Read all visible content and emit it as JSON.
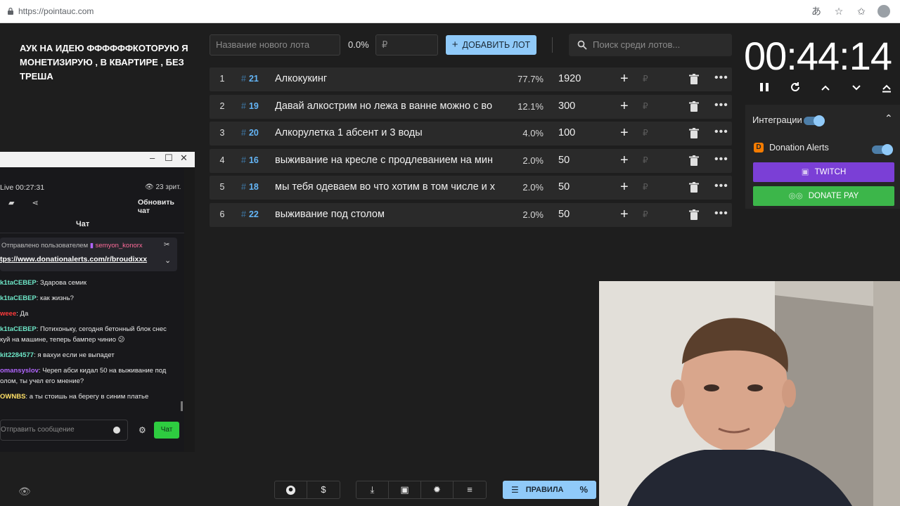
{
  "browser": {
    "url": "https://pointauc.com",
    "icons": [
      "translate-icon",
      "star-icon",
      "bookmarks-icon",
      "profile-icon"
    ]
  },
  "auction": {
    "title": "АУК НА ИДЕЮ ФФФФФФКОТОРУЮ Я МОНЕТИЗИРУЮ , В КВАРТИРЕ , БЕЗ ТРЕША"
  },
  "controls": {
    "new_lot_placeholder": "Название нового лота",
    "percent": "0.0%",
    "amount_placeholder": "₽",
    "add_lot_label": "ДОБАВИТЬ ЛОТ",
    "search_placeholder": "Поиск среди лотов..."
  },
  "lots": [
    {
      "num": "1",
      "id": "21",
      "name": "Алкокукинг",
      "pct": "77.7%",
      "amount": "1920"
    },
    {
      "num": "2",
      "id": "19",
      "name": "Давай алкострим но лежа в ванне можно с во",
      "pct": "12.1%",
      "amount": "300"
    },
    {
      "num": "3",
      "id": "20",
      "name": "Алкорулетка 1 абсент и 3 воды",
      "pct": "4.0%",
      "amount": "100"
    },
    {
      "num": "4",
      "id": "16",
      "name": "выживание на кресле с продлеванием на мин",
      "pct": "2.0%",
      "amount": "50"
    },
    {
      "num": "5",
      "id": "18",
      "name": "мы тебя одеваем во что хотим в том числе и х",
      "pct": "2.0%",
      "amount": "50"
    },
    {
      "num": "6",
      "id": "22",
      "name": "выживание под столом",
      "pct": "2.0%",
      "amount": "50"
    }
  ],
  "lot_row": {
    "hash": "#",
    "plus": "+",
    "rub": "₽",
    "dots": "•••"
  },
  "timer": {
    "value": "00:44:14",
    "controls": [
      "pause-icon",
      "restart-icon",
      "increase-icon",
      "decrease-icon",
      "top-icon"
    ]
  },
  "integrations": {
    "label": "Интеграции",
    "enabled": true,
    "donation_alerts": "Donation Alerts",
    "donation_alerts_logo": "D",
    "twitch": "TWITCH",
    "donate_pay": "DONATE PAY",
    "colors": {
      "twitch": "#7b3fd6",
      "donate_pay": "#3cb64a",
      "accent": "#90caf9"
    }
  },
  "chat_window": {
    "controls": [
      "minimize-icon",
      "maximize-icon",
      "close-icon"
    ],
    "live": "Live 00:27:31",
    "viewers": "23 зрит.",
    "refresh": "Обновить чат",
    "tab": "Чат",
    "pinned_prefix": "Отправлено пользователем",
    "pinned_user": "semyon_konorx",
    "pinned_link": "tps://www.donationalerts.com/r/broudixxx",
    "messages": [
      {
        "user": "k1taСЕВЕР",
        "color": "#6ee7c8",
        "text": ": Здарова семик"
      },
      {
        "user": "k1taСЕВЕР",
        "color": "#6ee7c8",
        "text": ": как жизнь?"
      },
      {
        "user": "weee",
        "color": "#ff3b3b",
        "text": ": Да"
      },
      {
        "user": "k1taСЕВЕР",
        "color": "#6ee7c8",
        "text": ": Потихоньку, сегодня бетонный блок снес"
      },
      {
        "user": "",
        "color": "#e8e8e8",
        "text": "куй на машине, теперь бампер чинио 😕"
      },
      {
        "user": "kit2284577",
        "color": "#6ee7c8",
        "text": ": я вахуи если не выпадет"
      },
      {
        "user": "omansyslov",
        "color": "#b266ff",
        "text": ": Череп абси кидал 50 на выживание под"
      },
      {
        "user": "",
        "color": "#e8e8e8",
        "text": "олом, ты учел его мнение?"
      },
      {
        "user": "OWNBS",
        "color": "#ffe066",
        "text": ": а ты стоишь на берегу в синим платье"
      }
    ],
    "input_placeholder": "Отправить сообщение",
    "send": "Чат"
  },
  "bottom_toolbar": {
    "group1": [
      "github-icon",
      "dollar-icon"
    ],
    "group2": [
      "download-icon",
      "save-icon",
      "bug-icon",
      "clear-icon"
    ],
    "rules": "ПРАВИЛА",
    "percent_icon": "%"
  }
}
